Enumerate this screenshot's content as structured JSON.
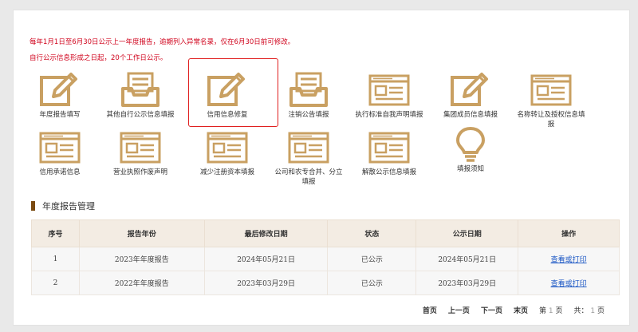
{
  "notices": [
    "每年1月1日至6月30日公示上一年度报告，逾期列入异常名录，仅在6月30日前可修改。",
    "自行公示信息形成之日起，20个工作日公示。"
  ],
  "colors": {
    "icon": "#c9a062",
    "highlight": "#e02020",
    "header_bg": "#f3ece3",
    "link": "#1a56c4"
  },
  "tiles": [
    {
      "label": "年度报告填写",
      "icon": "pencil-icon"
    },
    {
      "label": "其他自行公示信息填报",
      "icon": "inbox-tray-icon"
    },
    {
      "label": "信用信息修复",
      "icon": "pencil-icon"
    },
    {
      "label": "注销公告填报",
      "icon": "inbox-tray-icon"
    },
    {
      "label": "执行标准自我声明填报",
      "icon": "browser-window-icon"
    },
    {
      "label": "集团成员信息填报",
      "icon": "pencil-icon"
    },
    {
      "label": "名称转让及授权信息填报",
      "icon": "browser-window-icon"
    },
    {
      "label": "信用承诺信息",
      "icon": "browser-window-icon"
    },
    {
      "label": "营业执照作废声明",
      "icon": "browser-window-icon"
    },
    {
      "label": "减少注册资本填报",
      "icon": "browser-window-icon"
    },
    {
      "label": "公司和农专合并、分立填报",
      "icon": "browser-window-icon"
    },
    {
      "label": "解散公示信息填报",
      "icon": "browser-window-icon"
    },
    {
      "label": "填报须知",
      "icon": "lightbulb-icon"
    }
  ],
  "section": {
    "title": "年度报告管理"
  },
  "table": {
    "headers": [
      "序号",
      "报告年份",
      "最后修改日期",
      "状态",
      "公示日期",
      "操作"
    ],
    "rows": [
      [
        "1",
        "2023年年度报告",
        "2024年05月21日",
        "已公示",
        "2024年05月21日",
        "查看或打印"
      ],
      [
        "2",
        "2022年年度报告",
        "2023年03月29日",
        "已公示",
        "2023年03月29日",
        "查看或打印"
      ]
    ]
  },
  "pager": {
    "first": "首页",
    "prev": "上一页",
    "next": "下一页",
    "last": "末页",
    "page_prefix": "第",
    "page_num": "1",
    "page_suffix": "页",
    "total_prefix": "共：",
    "total_num": "1",
    "total_suffix": "页"
  }
}
